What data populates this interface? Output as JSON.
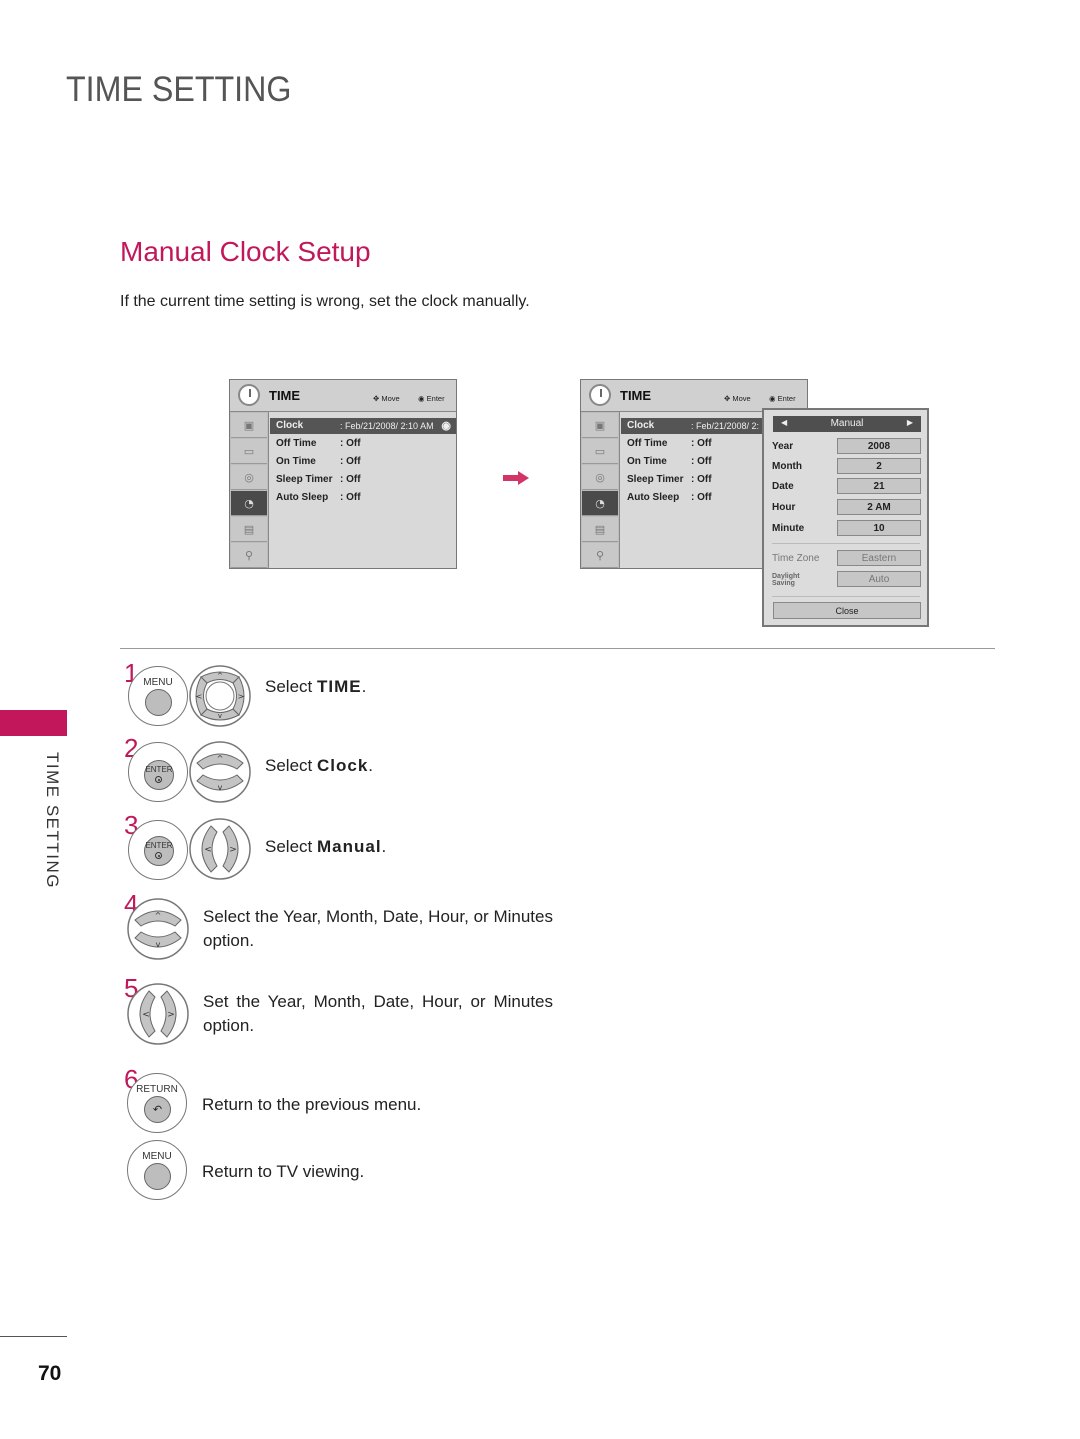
{
  "page": {
    "title": "TIME SETTING",
    "section_title": "Manual Clock Setup",
    "intro": "If the current time setting is wrong, set the clock manually.",
    "side_tab": "TIME SETTING",
    "page_number": "70",
    "accent_color": "#c2185b"
  },
  "osd_left": {
    "title": "TIME",
    "hint_move": "Move",
    "hint_enter": "Enter",
    "sidebar_icons": [
      "picture-icon",
      "screen-icon",
      "audio-icon",
      "time-icon",
      "option-icon",
      "lock-icon"
    ],
    "active_sidebar_index": 3,
    "rows": [
      {
        "label": "Clock",
        "value": ": Feb/21/2008/  2:10 AM"
      },
      {
        "label": "Off Time",
        "value": ": Off"
      },
      {
        "label": "On Time",
        "value": ": Off"
      },
      {
        "label": "Sleep Timer",
        "value": ": Off"
      },
      {
        "label": "Auto Sleep",
        "value": ": Off"
      }
    ]
  },
  "osd_right": {
    "title": "TIME",
    "hint_move": "Move",
    "hint_enter": "Enter",
    "rows": [
      {
        "label": "Clock",
        "value": ": Feb/21/2008/  2:"
      },
      {
        "label": "Off Time",
        "value": ": Off"
      },
      {
        "label": "On Time",
        "value": ": Off"
      },
      {
        "label": "Sleep Timer",
        "value": ": Off"
      },
      {
        "label": "Auto Sleep",
        "value": ": Off"
      }
    ]
  },
  "popup": {
    "mode": "Manual",
    "fields": [
      {
        "label": "Year",
        "value": "2008"
      },
      {
        "label": "Month",
        "value": "2"
      },
      {
        "label": "Date",
        "value": "21"
      },
      {
        "label": "Hour",
        "value": "2 AM"
      },
      {
        "label": "Minute",
        "value": "10"
      }
    ],
    "time_zone_label": "Time Zone",
    "time_zone_value": "Eastern",
    "daylight_label_1": "Daylight",
    "daylight_label_2": "Saving",
    "daylight_value": "Auto",
    "close_label": "Close"
  },
  "steps": [
    {
      "num": "1",
      "button": "MENU",
      "text_prefix": "Select ",
      "text_bold": "TIME",
      "text_suffix": "."
    },
    {
      "num": "2",
      "button": "ENTER",
      "text_prefix": "Select ",
      "text_bold": "Clock",
      "text_suffix": "."
    },
    {
      "num": "3",
      "button": "ENTER",
      "text_prefix": "Select ",
      "text_bold": "Manual",
      "text_suffix": "."
    },
    {
      "num": "4",
      "text": "Select the Year, Month, Date, Hour, or Minutes option."
    },
    {
      "num": "5",
      "text": "Set the Year, Month, Date, Hour, or Minutes option."
    },
    {
      "num": "6",
      "button": "RETURN",
      "text": "Return to the previous menu."
    },
    {
      "button": "MENU",
      "text": "Return to TV viewing."
    }
  ]
}
